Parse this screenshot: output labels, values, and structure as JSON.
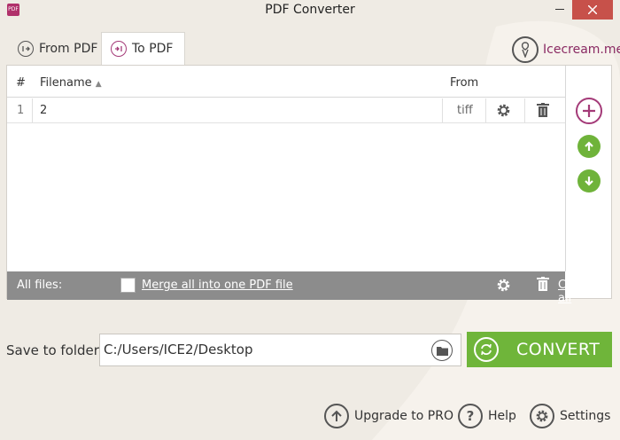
{
  "window": {
    "title": "PDF Converter",
    "app_icon_text": "PDF"
  },
  "tabs": [
    {
      "label": "From PDF",
      "active": false
    },
    {
      "label": "To PDF",
      "active": true
    }
  ],
  "brand": "Icecream.me",
  "table": {
    "columns": {
      "index": "#",
      "filename": "Filename",
      "from": "From"
    },
    "rows": [
      {
        "index": "1",
        "filename": "2",
        "from": "tiff"
      }
    ]
  },
  "footer": {
    "all_files": "All files:",
    "merge_label": "Merge all into one PDF file",
    "merge_checked": false,
    "clear_all": "Clear all"
  },
  "save": {
    "label": "Save to folder:",
    "path": "C:/Users/ICE2/Desktop"
  },
  "convert_label": "CONVERT",
  "bottom": {
    "upgrade": "Upgrade to PRO",
    "help": "Help",
    "settings": "Settings"
  },
  "icons": {
    "from_pdf": "pdf-out-icon",
    "to_pdf": "pdf-in-icon",
    "brand": "icecream-logo-icon",
    "add": "plus-icon",
    "up": "arrow-up-icon",
    "down": "arrow-down-icon",
    "gear": "gear-icon",
    "trash": "trash-icon",
    "folder": "folder-icon",
    "convert": "refresh-icon",
    "upgrade": "arrow-up-circle-icon",
    "help": "question-icon"
  },
  "colors": {
    "accent": "#a43a78",
    "convert": "#6fb53a",
    "footer": "#8c8c8c",
    "close": "#c7514a"
  }
}
